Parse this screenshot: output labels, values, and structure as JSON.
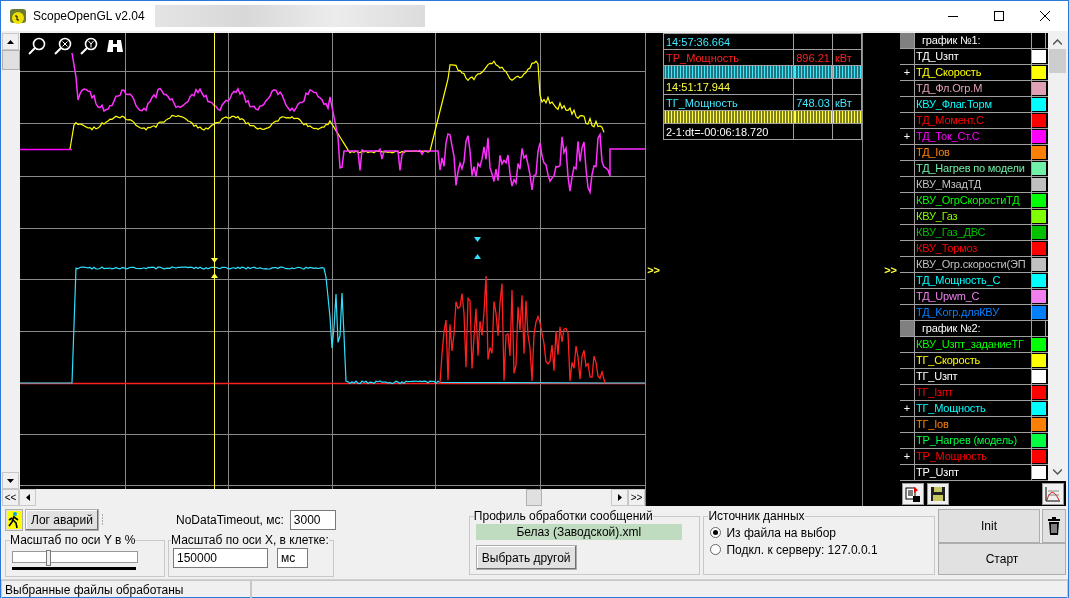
{
  "window": {
    "title": "ScopeOpenGL v2.04"
  },
  "scope": {
    "scroll_left": "<<",
    "scroll_right": ">>"
  },
  "splitters": [
    ">>",
    ">>"
  ],
  "readout": {
    "rows": [
      {
        "kind": "time",
        "text": "14:57:36.664",
        "color": "#40e8ff"
      },
      {
        "kind": "value",
        "name": "ТР_Мощность",
        "value": "896.21",
        "unit": "кВт",
        "color": "#ff2020"
      },
      {
        "kind": "bar",
        "color": "#40e8ff"
      },
      {
        "kind": "time",
        "text": "14:51:17.944",
        "color": "#ffff40"
      },
      {
        "kind": "value",
        "name": "ТГ_Мощность",
        "value": "748.03",
        "unit": "кВт",
        "color": "#40e8ff"
      },
      {
        "kind": "bar",
        "color": "#ffff40"
      },
      {
        "kind": "time",
        "text": "2-1:dt=-00:06:18.720",
        "color": "#ffffff"
      }
    ]
  },
  "channels": {
    "items": [
      {
        "kind": "header",
        "label": "график №1:"
      },
      {
        "kind": "channel",
        "name": "ТД_Uзпт",
        "color": "#ffffff"
      },
      {
        "kind": "channel",
        "name": "ТД_Скорость",
        "color": "#ffff00",
        "marker": "+"
      },
      {
        "kind": "channel",
        "name": "ТД_Фл.Огр.М",
        "color": "#e0a0b8"
      },
      {
        "kind": "channel",
        "name": "КВУ_Флаг.Торм",
        "color": "#00ffff"
      },
      {
        "kind": "channel",
        "name": "ТД_Момент.С",
        "color": "#ff0000"
      },
      {
        "kind": "channel",
        "name": "ТД_Ток_Ст.С",
        "color": "#ff00ff",
        "marker": "+"
      },
      {
        "kind": "channel",
        "name": "ТД_Iов",
        "color": "#ff8000"
      },
      {
        "kind": "channel",
        "name": "ТД_Нагрев по модели",
        "color": "#70f0a8"
      },
      {
        "kind": "channel",
        "name": "КВУ_МзадТД",
        "color": "#c0c0c0"
      },
      {
        "kind": "channel",
        "name": "КВУ_ОгрСкоростиТД",
        "color": "#00ff00"
      },
      {
        "kind": "channel",
        "name": "КВУ_Газ",
        "color": "#80ff00"
      },
      {
        "kind": "channel",
        "name": "КВУ_Газ_ДВС",
        "color": "#00c000"
      },
      {
        "kind": "channel",
        "name": "КВУ_Тормоз",
        "color": "#ff0000"
      },
      {
        "kind": "channel",
        "name": "КВУ_Огр.скорости(ЭП",
        "color": "#c0c0c0"
      },
      {
        "kind": "channel",
        "name": "ТД_Мощность_С",
        "color": "#00ffff"
      },
      {
        "kind": "channel",
        "name": "ТД_Upwm_C",
        "color": "#f080f0"
      },
      {
        "kind": "channel",
        "name": "ТД_Kогр.дляКВУ",
        "color": "#0080ff"
      },
      {
        "kind": "header",
        "label": "график №2:"
      },
      {
        "kind": "channel",
        "name": "КВУ_Uзпт_заданиеТГ",
        "color": "#00ff00"
      },
      {
        "kind": "channel",
        "name": "ТГ_Скорость",
        "color": "#ffff00"
      },
      {
        "kind": "channel",
        "name": "ТГ_Uзпт",
        "color": "#ffffff"
      },
      {
        "kind": "channel",
        "name": "ТГ_Iзпт",
        "color": "#ff0000"
      },
      {
        "kind": "channel",
        "name": "ТГ_Мощность",
        "color": "#00ffff",
        "marker": "+"
      },
      {
        "kind": "channel",
        "name": "ТГ_Iов",
        "color": "#ff8000"
      },
      {
        "kind": "channel",
        "name": "ТР_Нагрев (модель)",
        "color": "#00ff40"
      },
      {
        "kind": "channel",
        "name": "ТР_Мощность",
        "color": "#ff0000",
        "marker": "+"
      },
      {
        "kind": "channel",
        "name": "ТР_Uзпт",
        "color": "#ffffff"
      }
    ]
  },
  "controls": {
    "alarm_log_button": "Лог аварий",
    "y_scale": {
      "label": "Масштаб по оси Y в %",
      "level": 0.27
    },
    "timeout": {
      "label": "NoDataTimeout, мс:",
      "value": "3000"
    },
    "x_scale": {
      "label": "Масштаб по оси X, в клетке:",
      "value": "150000",
      "unit": "мс"
    },
    "profile": {
      "label": "Профиль обработки сообщений",
      "file": "Белаз (Заводской).xml",
      "button": "Выбрать другой"
    },
    "source": {
      "label": "Источник данных",
      "options": [
        {
          "label": "Из файла на выбор",
          "selected": true
        },
        {
          "label": "Подкл. к серверу: 127.0.0.1",
          "selected": false
        }
      ]
    },
    "init_button": "Init",
    "start_button": "Старт"
  },
  "status_bar": {
    "text": "Выбранные файлы обработаны"
  }
}
